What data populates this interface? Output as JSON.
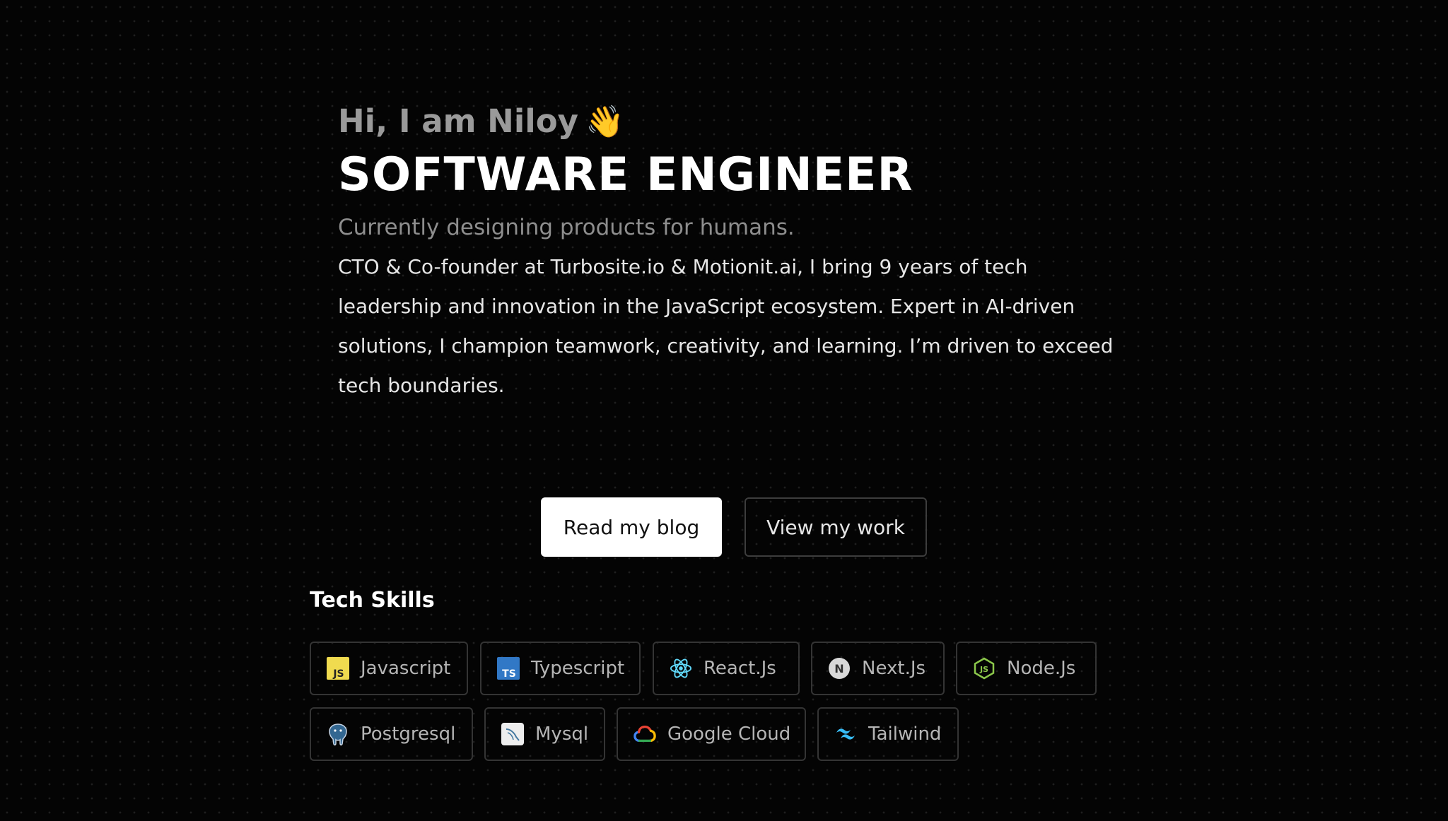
{
  "hero": {
    "greeting": "Hi, I am Niloy",
    "greeting_emoji": "👋",
    "role": "SOFTWARE ENGINEER",
    "tagline": "Currently designing products for humans.",
    "bio": "CTO & Co-founder at Turbosite.io & Motionit.ai, I bring 9 years of tech leadership and innovation in the JavaScript ecosystem. Expert in AI-driven solutions, I champion teamwork, creativity, and learning. I’m driven to exceed tech boundaries."
  },
  "actions": {
    "read_blog": "Read my blog",
    "view_work": "View my work"
  },
  "skills": {
    "title": "Tech Skills",
    "items": [
      {
        "label": "Javascript",
        "icon": "javascript-icon"
      },
      {
        "label": "Typescript",
        "icon": "typescript-icon"
      },
      {
        "label": "React.Js",
        "icon": "react-icon"
      },
      {
        "label": "Next.Js",
        "icon": "nextjs-icon"
      },
      {
        "label": "Node.Js",
        "icon": "nodejs-icon"
      },
      {
        "label": "Postgresql",
        "icon": "postgresql-icon"
      },
      {
        "label": "Mysql",
        "icon": "mysql-icon"
      },
      {
        "label": "Google Cloud",
        "icon": "google-cloud-icon"
      },
      {
        "label": "Tailwind",
        "icon": "tailwind-icon"
      }
    ]
  },
  "colors": {
    "background": "#040404",
    "primary_text": "#ffffff",
    "muted_text": "#9a9a9a",
    "chip_border": "#343434",
    "javascript": "#f0db4f",
    "typescript": "#3178c6",
    "react": "#61dafb",
    "nodejs": "#8cc84b",
    "tailwind": "#38bdf8"
  }
}
